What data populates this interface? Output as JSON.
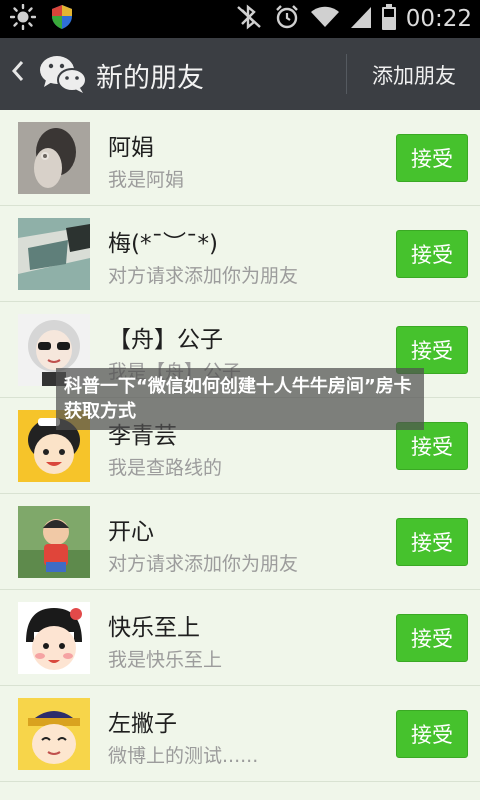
{
  "status_bar": {
    "time": "00:22",
    "icons": [
      "brightness-icon",
      "shield-icon",
      "bluetooth-off-icon",
      "alarm-icon",
      "wifi-icon",
      "signal-icon",
      "battery-icon"
    ]
  },
  "title_bar": {
    "title": "新的朋友",
    "add_friend_label": "添加朋友"
  },
  "friends": [
    {
      "name": "阿娟",
      "message": "我是阿娟",
      "button": "接受"
    },
    {
      "name": "梅(*¯︶¯*)",
      "message": "对方请求添加你为朋友",
      "button": "接受"
    },
    {
      "name": "【舟】公子",
      "message": "我是【舟】公子",
      "button": "接受"
    },
    {
      "name": "李青芸",
      "message": "我是查路线的",
      "button": "接受"
    },
    {
      "name": "开心",
      "message": "对方请求添加你为朋友",
      "button": "接受"
    },
    {
      "name": "快乐至上",
      "message": "我是快乐至上",
      "button": "接受"
    },
    {
      "name": "左撇子",
      "message": "微博上的测试......",
      "button": "接受"
    }
  ],
  "overlay": {
    "text": "科普一下“微信如何创建十人牛牛房间”房卡获取方式"
  },
  "colors": {
    "accept_button": "#46c22d",
    "title_bar": "#3b3e43",
    "list_background": "#f0f6ea"
  }
}
